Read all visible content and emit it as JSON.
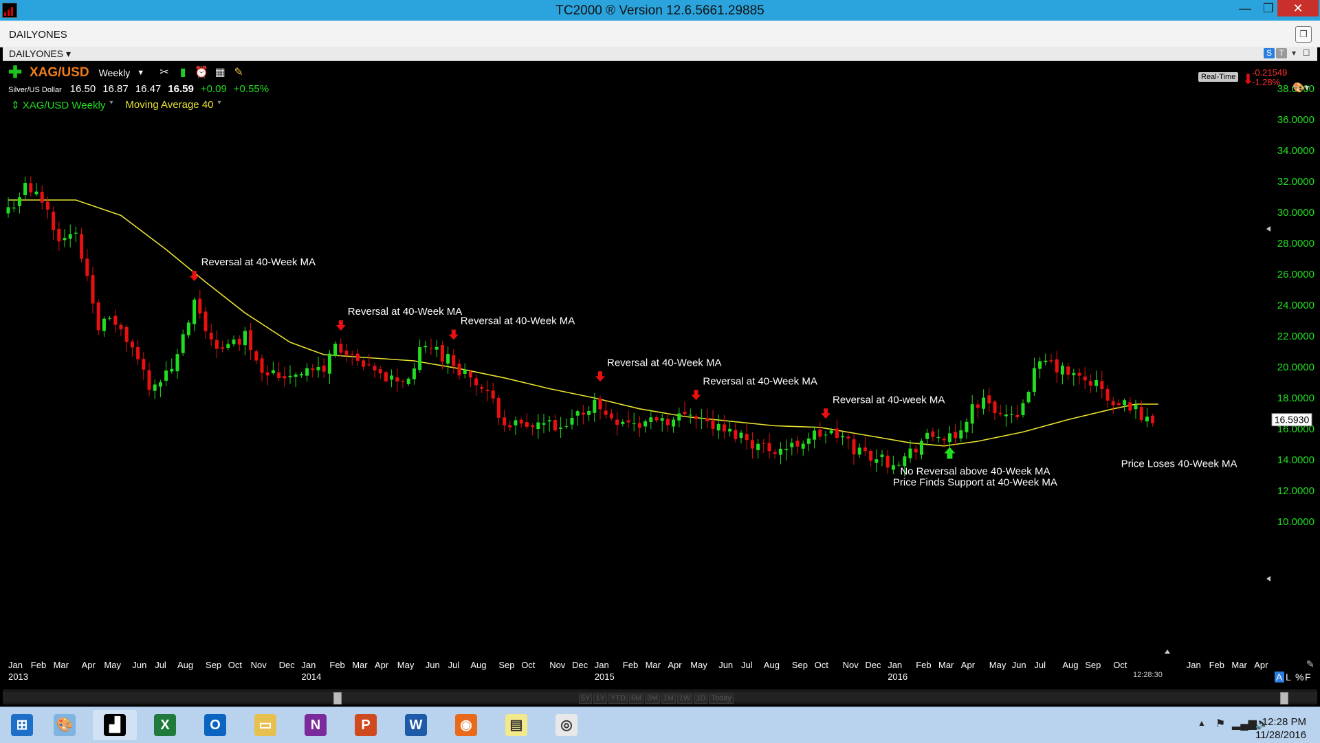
{
  "window": {
    "title": "TC2000 ® Version 12.6.5661.29885",
    "minimize": "—",
    "maximize": "❐",
    "close": "✕"
  },
  "layout_tab": {
    "label": "DAILYONES"
  },
  "chart_window": {
    "label": "DAILYONES ▾",
    "icons": [
      "S",
      "T",
      "▾",
      "☐"
    ]
  },
  "symbol_bar": {
    "add": "✚",
    "symbol": "XAG/USD",
    "timeframe": "Weekly",
    "timeframe_arrow": "▼",
    "tools": [
      {
        "name": "tools-icon",
        "glyph": "✂",
        "color": "#dddddd"
      },
      {
        "name": "indicators-icon",
        "glyph": "▮",
        "color": "#22cc22"
      },
      {
        "name": "alarm-clock-icon",
        "glyph": "⏰",
        "color": "#ff3b30"
      },
      {
        "name": "calculator-icon",
        "glyph": "▦",
        "color": "#dddddd"
      },
      {
        "name": "pencil-icon",
        "glyph": "✎",
        "color": "#e8c040"
      }
    ]
  },
  "quote": {
    "name": "Silver/US Dollar",
    "open": "16.50",
    "high": "16.87",
    "low": "16.47",
    "last": "16.59",
    "change": "+0.09",
    "change_pct": "+0.55%"
  },
  "legend": {
    "series": "⇕ XAG/USD Weekly",
    "series_arrow": "▾",
    "ma": "Moving Average 40",
    "ma_arrow": "▾"
  },
  "realtime": {
    "label": "Real-Time",
    "arrow": "⬇",
    "change": "-0.21549",
    "change_pct": "-1.28%",
    "palette": "🎨▾"
  },
  "colors": {
    "up": "#22dd22",
    "down": "#e81010",
    "ma": "#e8e230",
    "axis_text": "#22dd22",
    "annotation": "#ffffff"
  },
  "chart_data": {
    "type": "candlestick",
    "title": "",
    "xlabel": "",
    "ylabel": "",
    "ylim": [
      10,
      38
    ],
    "y_ticks": [
      "10.0000",
      "12.0000",
      "14.0000",
      "16.0000",
      "18.0000",
      "20.0000",
      "22.0000",
      "24.0000",
      "26.0000",
      "28.0000",
      "30.0000",
      "32.0000",
      "34.0000",
      "36.0000",
      "38.0000"
    ],
    "y_tick_values": [
      10,
      12,
      14,
      16,
      18,
      20,
      22,
      24,
      26,
      28,
      30,
      32,
      34,
      36,
      38
    ],
    "current_price_label": "16.5930",
    "current_price": 16.593,
    "x_ticks": [
      {
        "label": "Jan",
        "week": 0
      },
      {
        "label": "Feb",
        "week": 4
      },
      {
        "label": "Mar",
        "week": 8
      },
      {
        "label": "Apr",
        "week": 13
      },
      {
        "label": "May",
        "week": 17
      },
      {
        "label": "Jun",
        "week": 22
      },
      {
        "label": "Jul",
        "week": 26
      },
      {
        "label": "Aug",
        "week": 30
      },
      {
        "label": "Sep",
        "week": 35
      },
      {
        "label": "Oct",
        "week": 39
      },
      {
        "label": "Nov",
        "week": 43
      },
      {
        "label": "Dec",
        "week": 48
      },
      {
        "label": "Jan",
        "week": 52
      },
      {
        "label": "Feb",
        "week": 57
      },
      {
        "label": "Mar",
        "week": 61
      },
      {
        "label": "Apr",
        "week": 65
      },
      {
        "label": "May",
        "week": 69
      },
      {
        "label": "Jun",
        "week": 74
      },
      {
        "label": "Jul",
        "week": 78
      },
      {
        "label": "Aug",
        "week": 82
      },
      {
        "label": "Sep",
        "week": 87
      },
      {
        "label": "Oct",
        "week": 91
      },
      {
        "label": "Nov",
        "week": 96
      },
      {
        "label": "Dec",
        "week": 100
      },
      {
        "label": "Jan",
        "week": 104
      },
      {
        "label": "Feb",
        "week": 109
      },
      {
        "label": "Mar",
        "week": 113
      },
      {
        "label": "Apr",
        "week": 117
      },
      {
        "label": "May",
        "week": 121
      },
      {
        "label": "Jun",
        "week": 126
      },
      {
        "label": "Jul",
        "week": 130
      },
      {
        "label": "Aug",
        "week": 134
      },
      {
        "label": "Sep",
        "week": 139
      },
      {
        "label": "Oct",
        "week": 143
      },
      {
        "label": "Nov",
        "week": 148
      },
      {
        "label": "Dec",
        "week": 152
      },
      {
        "label": "Jan",
        "week": 156
      },
      {
        "label": "Feb",
        "week": 161
      },
      {
        "label": "Mar",
        "week": 165
      },
      {
        "label": "Apr",
        "week": 169
      },
      {
        "label": "May",
        "week": 174
      },
      {
        "label": "Jun",
        "week": 178
      },
      {
        "label": "Jul",
        "week": 182
      },
      {
        "label": "Aug",
        "week": 187
      },
      {
        "label": "Sep",
        "week": 191
      },
      {
        "label": "Oct",
        "week": 196
      },
      {
        "label": "Jan",
        "week": 209
      },
      {
        "label": "Feb",
        "week": 213
      },
      {
        "label": "Mar",
        "week": 217
      },
      {
        "label": "Apr",
        "week": 221
      }
    ],
    "year_labels": [
      {
        "label": "2013",
        "week": 0
      },
      {
        "label": "2014",
        "week": 52
      },
      {
        "label": "2015",
        "week": 104
      },
      {
        "label": "2016",
        "week": 156
      }
    ],
    "time_label": "12:28:30",
    "corner_labels": [
      "A",
      "L",
      "%",
      "F"
    ],
    "close_anchors": [
      [
        0,
        30.2
      ],
      [
        3,
        31.6
      ],
      [
        6,
        30.8
      ],
      [
        9,
        28.5
      ],
      [
        12,
        28.4
      ],
      [
        14,
        26
      ],
      [
        16,
        22.8
      ],
      [
        19,
        22.9
      ],
      [
        23,
        20.4
      ],
      [
        25,
        18.9
      ],
      [
        28,
        19.4
      ],
      [
        30,
        20.6
      ],
      [
        33,
        24
      ],
      [
        35,
        22.4
      ],
      [
        38,
        21
      ],
      [
        42,
        22.1
      ],
      [
        45,
        20
      ],
      [
        48,
        19.4
      ],
      [
        52,
        19.8
      ],
      [
        56,
        19.8
      ],
      [
        58,
        21.6
      ],
      [
        61,
        20.4
      ],
      [
        64,
        19.7
      ],
      [
        68,
        19.2
      ],
      [
        71,
        19.2
      ],
      [
        73,
        20.9
      ],
      [
        75,
        21.4
      ],
      [
        78,
        20.5
      ],
      [
        82,
        19.3
      ],
      [
        85,
        18.1
      ],
      [
        88,
        16.6
      ],
      [
        92,
        15.9
      ],
      [
        95,
        16.4
      ],
      [
        98,
        15.7
      ],
      [
        101,
        16.9
      ],
      [
        104,
        17.7
      ],
      [
        106,
        16.9
      ],
      [
        109,
        16.6
      ],
      [
        112,
        16.2
      ],
      [
        115,
        16.8
      ],
      [
        118,
        16.5
      ],
      [
        121,
        17.2
      ],
      [
        124,
        16.4
      ],
      [
        127,
        15.8
      ],
      [
        130,
        15.6
      ],
      [
        133,
        14.9
      ],
      [
        136,
        14.7
      ],
      [
        139,
        14.8
      ],
      [
        142,
        15.5
      ],
      [
        145,
        15.7
      ],
      [
        148,
        15.4
      ],
      [
        150,
        14.7
      ],
      [
        153,
        14.3
      ],
      [
        156,
        13.9
      ],
      [
        159,
        14.1
      ],
      [
        162,
        15.2
      ],
      [
        165,
        15.6
      ],
      [
        168,
        15.1
      ],
      [
        171,
        17.5
      ],
      [
        174,
        17.8
      ],
      [
        176,
        16.9
      ],
      [
        178,
        16.6
      ],
      [
        180,
        17.8
      ],
      [
        182,
        19.6
      ],
      [
        184,
        20.3
      ],
      [
        187,
        19.7
      ],
      [
        190,
        19.2
      ],
      [
        193,
        18.9
      ],
      [
        196,
        17.4
      ],
      [
        199,
        17.6
      ],
      [
        201,
        16.8
      ],
      [
        203,
        16.59
      ]
    ],
    "ma_anchors": [
      [
        0,
        30.8
      ],
      [
        12,
        30.8
      ],
      [
        20,
        29.8
      ],
      [
        28,
        27.6
      ],
      [
        35,
        25.5
      ],
      [
        42,
        23.5
      ],
      [
        50,
        21.6
      ],
      [
        56,
        20.8
      ],
      [
        64,
        20.6
      ],
      [
        72,
        20.4
      ],
      [
        80,
        19.9
      ],
      [
        88,
        19.3
      ],
      [
        96,
        18.6
      ],
      [
        104,
        18
      ],
      [
        112,
        17.3
      ],
      [
        120,
        16.8
      ],
      [
        128,
        16.5
      ],
      [
        136,
        16.2
      ],
      [
        144,
        16.1
      ],
      [
        152,
        15.6
      ],
      [
        160,
        15.1
      ],
      [
        166,
        14.9
      ],
      [
        172,
        15.2
      ],
      [
        180,
        15.8
      ],
      [
        188,
        16.6
      ],
      [
        196,
        17.3
      ],
      [
        200,
        17.6
      ],
      [
        204,
        17.6
      ]
    ],
    "annotations": [
      {
        "text": "Reversal at 40-Week MA",
        "week": 33,
        "price": 25.6,
        "arrow": "down",
        "color": "#e81010"
      },
      {
        "text": "Reversal at 40-Week MA",
        "week": 59,
        "price": 22.4,
        "arrow": "down",
        "color": "#e81010"
      },
      {
        "text": "Reversal at 40-Week MA",
        "week": 79,
        "price": 21.8,
        "arrow": "down",
        "color": "#e81010"
      },
      {
        "text": "Reversal at 40-Week MA",
        "week": 105,
        "price": 19.1,
        "arrow": "down",
        "color": "#e81010"
      },
      {
        "text": "Reversal at 40-Week MA",
        "week": 122,
        "price": 17.9,
        "arrow": "down",
        "color": "#e81010"
      },
      {
        "text": "Reversal at 40-week MA",
        "week": 145,
        "price": 16.7,
        "arrow": "down",
        "color": "#e81010"
      },
      {
        "text": "No Reversal above 40-Week MA",
        "text2": "Price Finds Support at 40-Week MA",
        "week": 167,
        "price": 14.2,
        "arrow": "up",
        "color": "#22dd22"
      },
      {
        "text": "Price Loses 40-Week MA",
        "week": 203,
        "price": 14.6,
        "arrow": "none",
        "color": "#22dd22"
      }
    ]
  },
  "range_buttons": [
    "5Y",
    "1Y",
    "YTD",
    "6M",
    "3M",
    "1M",
    "1W",
    "1D",
    "Today"
  ],
  "taskbar": {
    "apps": [
      {
        "name": "windows-start-icon",
        "color": "#1e6fc8",
        "glyph": "⊞"
      },
      {
        "name": "paint-icon",
        "color": "#7fb3e0",
        "glyph": "🎨"
      },
      {
        "name": "tc2000-icon",
        "color": "#000000",
        "glyph": "▟"
      },
      {
        "name": "excel-icon",
        "color": "#1f7a3c",
        "glyph": "X"
      },
      {
        "name": "outlook-icon",
        "color": "#0a64c0",
        "glyph": "O"
      },
      {
        "name": "file-explorer-icon",
        "color": "#e8c050",
        "glyph": "▭"
      },
      {
        "name": "onenote-icon",
        "color": "#7a2a9a",
        "glyph": "N"
      },
      {
        "name": "powerpoint-icon",
        "color": "#d04a20",
        "glyph": "P"
      },
      {
        "name": "word-icon",
        "color": "#1d5aa8",
        "glyph": "W"
      },
      {
        "name": "firefox-icon",
        "color": "#e86a1a",
        "glyph": "◉"
      },
      {
        "name": "sticky-notes-icon",
        "color": "#f3e88a",
        "glyph": "▤"
      },
      {
        "name": "chrome-icon",
        "color": "#e8e8e8",
        "glyph": "◎"
      }
    ],
    "time": "12:28 PM",
    "date": "11/28/2016"
  }
}
